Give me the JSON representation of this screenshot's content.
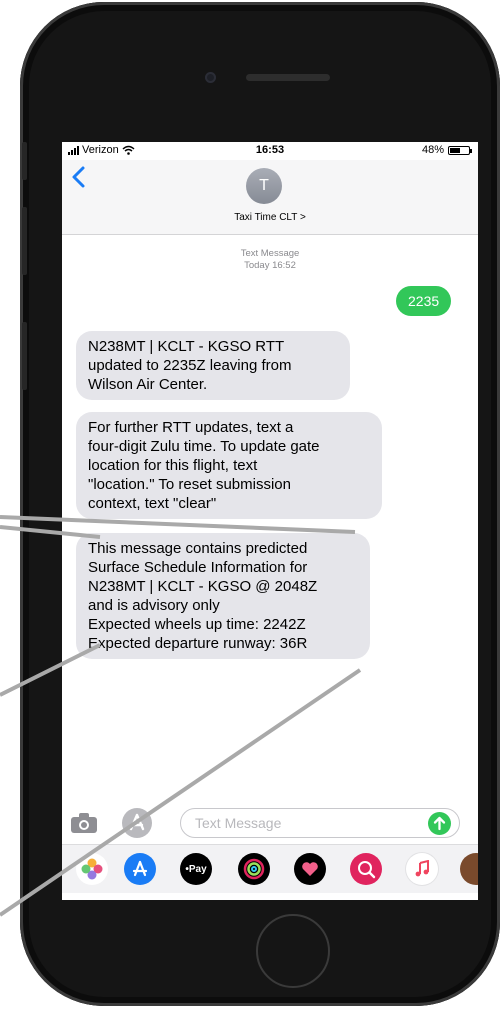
{
  "status": {
    "carrier": "Verizon",
    "time": "16:53",
    "battery": "48%"
  },
  "header": {
    "avatar_initial": "T",
    "contact_name": "Taxi Time CLT >"
  },
  "thread": {
    "meta_line1": "Text Message",
    "meta_line2": "Today 16:52",
    "outgoing": "2235",
    "messages": [
      "N238MT | KCLT - KGSO RTT\nupdated to 2235Z leaving from\nWilson Air Center.",
      "For further RTT updates, text a\nfour-digit Zulu time. To update gate\nlocation for this flight, text\n\"location.\" To reset submission\ncontext, text \"clear\"",
      "This message contains predicted\nSurface Schedule Information for\nN238MT | KCLT - KGSO @ 2048Z\nand is advisory only\nExpected wheels up time: 2242Z\nExpected departure runway: 36R"
    ]
  },
  "composer": {
    "placeholder": "Text Message"
  },
  "app_tray": {
    "apple_pay_label": "Pay"
  },
  "colors": {
    "imessage_green": "#32c759",
    "bubble_gray": "#e5e5ea",
    "ios_blue": "#1a7cf5"
  },
  "icons": [
    "back-chevron-icon",
    "camera-icon",
    "app-store-icon",
    "send-arrow-icon",
    "photos-icon",
    "apple-pay-icon",
    "activity-icon",
    "music-icon"
  ]
}
